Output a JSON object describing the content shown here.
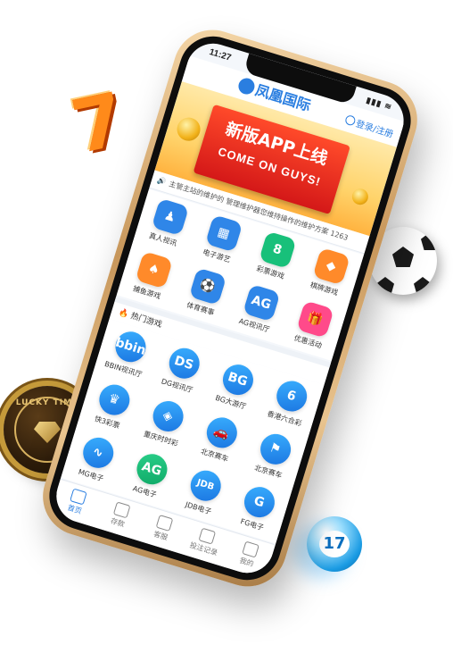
{
  "status": {
    "time": "11:27",
    "signal": "▮▮▮ ≋"
  },
  "header": {
    "logo_text": "凤凰国际",
    "login_label": "登录/注册"
  },
  "banner": {
    "title": "新版APP上线",
    "subtitle": "COME ON GUYS!"
  },
  "marquee": {
    "text": "主管主站的维护的 管理维护器您维持操作的维护方案 1263"
  },
  "games": [
    {
      "label": "真人视讯",
      "glyph": "♟",
      "color": "#2f86e8"
    },
    {
      "label": "电子游艺",
      "glyph": "▦",
      "color": "#2f86e8"
    },
    {
      "label": "彩票游戏",
      "glyph": "8",
      "color": "#18c07a"
    },
    {
      "label": "棋牌游戏",
      "glyph": "◆",
      "color": "#ff8a2a"
    },
    {
      "label": "捕鱼游戏",
      "glyph": "♠",
      "color": "#ff8a2a"
    },
    {
      "label": "体育赛事",
      "glyph": "⚽",
      "color": "#2f86e8"
    },
    {
      "label": "AG视讯厅",
      "glyph": "AG",
      "color": "#2f86e8"
    },
    {
      "label": "优惠活动",
      "glyph": "🎁",
      "color": "#ff4a8a"
    }
  ],
  "hot": {
    "title": "热门游戏"
  },
  "hot_games": [
    {
      "label": "BBIN视讯厅",
      "glyph": "bbin"
    },
    {
      "label": "DG视讯厅",
      "glyph": "DS"
    },
    {
      "label": "BG大游厅",
      "glyph": "BG"
    },
    {
      "label": "香港六合彩",
      "glyph": "6"
    },
    {
      "label": "快3彩票",
      "glyph": "♛"
    },
    {
      "label": "重庆时时彩",
      "glyph": "◈"
    },
    {
      "label": "北京赛车",
      "glyph": "🚗"
    },
    {
      "label": "北京赛车",
      "glyph": "⚑"
    },
    {
      "label": "MG电子",
      "glyph": "∿"
    },
    {
      "label": "AG电子",
      "glyph": "AG"
    },
    {
      "label": "JDB电子",
      "glyph": "JDB"
    },
    {
      "label": "FG电子",
      "glyph": "G"
    }
  ],
  "tabs": [
    {
      "label": "首页"
    },
    {
      "label": "存款"
    },
    {
      "label": "客服"
    },
    {
      "label": "投注记录"
    },
    {
      "label": "我的"
    }
  ],
  "deco": {
    "coin_text": "LUCKY TIME",
    "lotto_number": "17",
    "seven": "7"
  }
}
